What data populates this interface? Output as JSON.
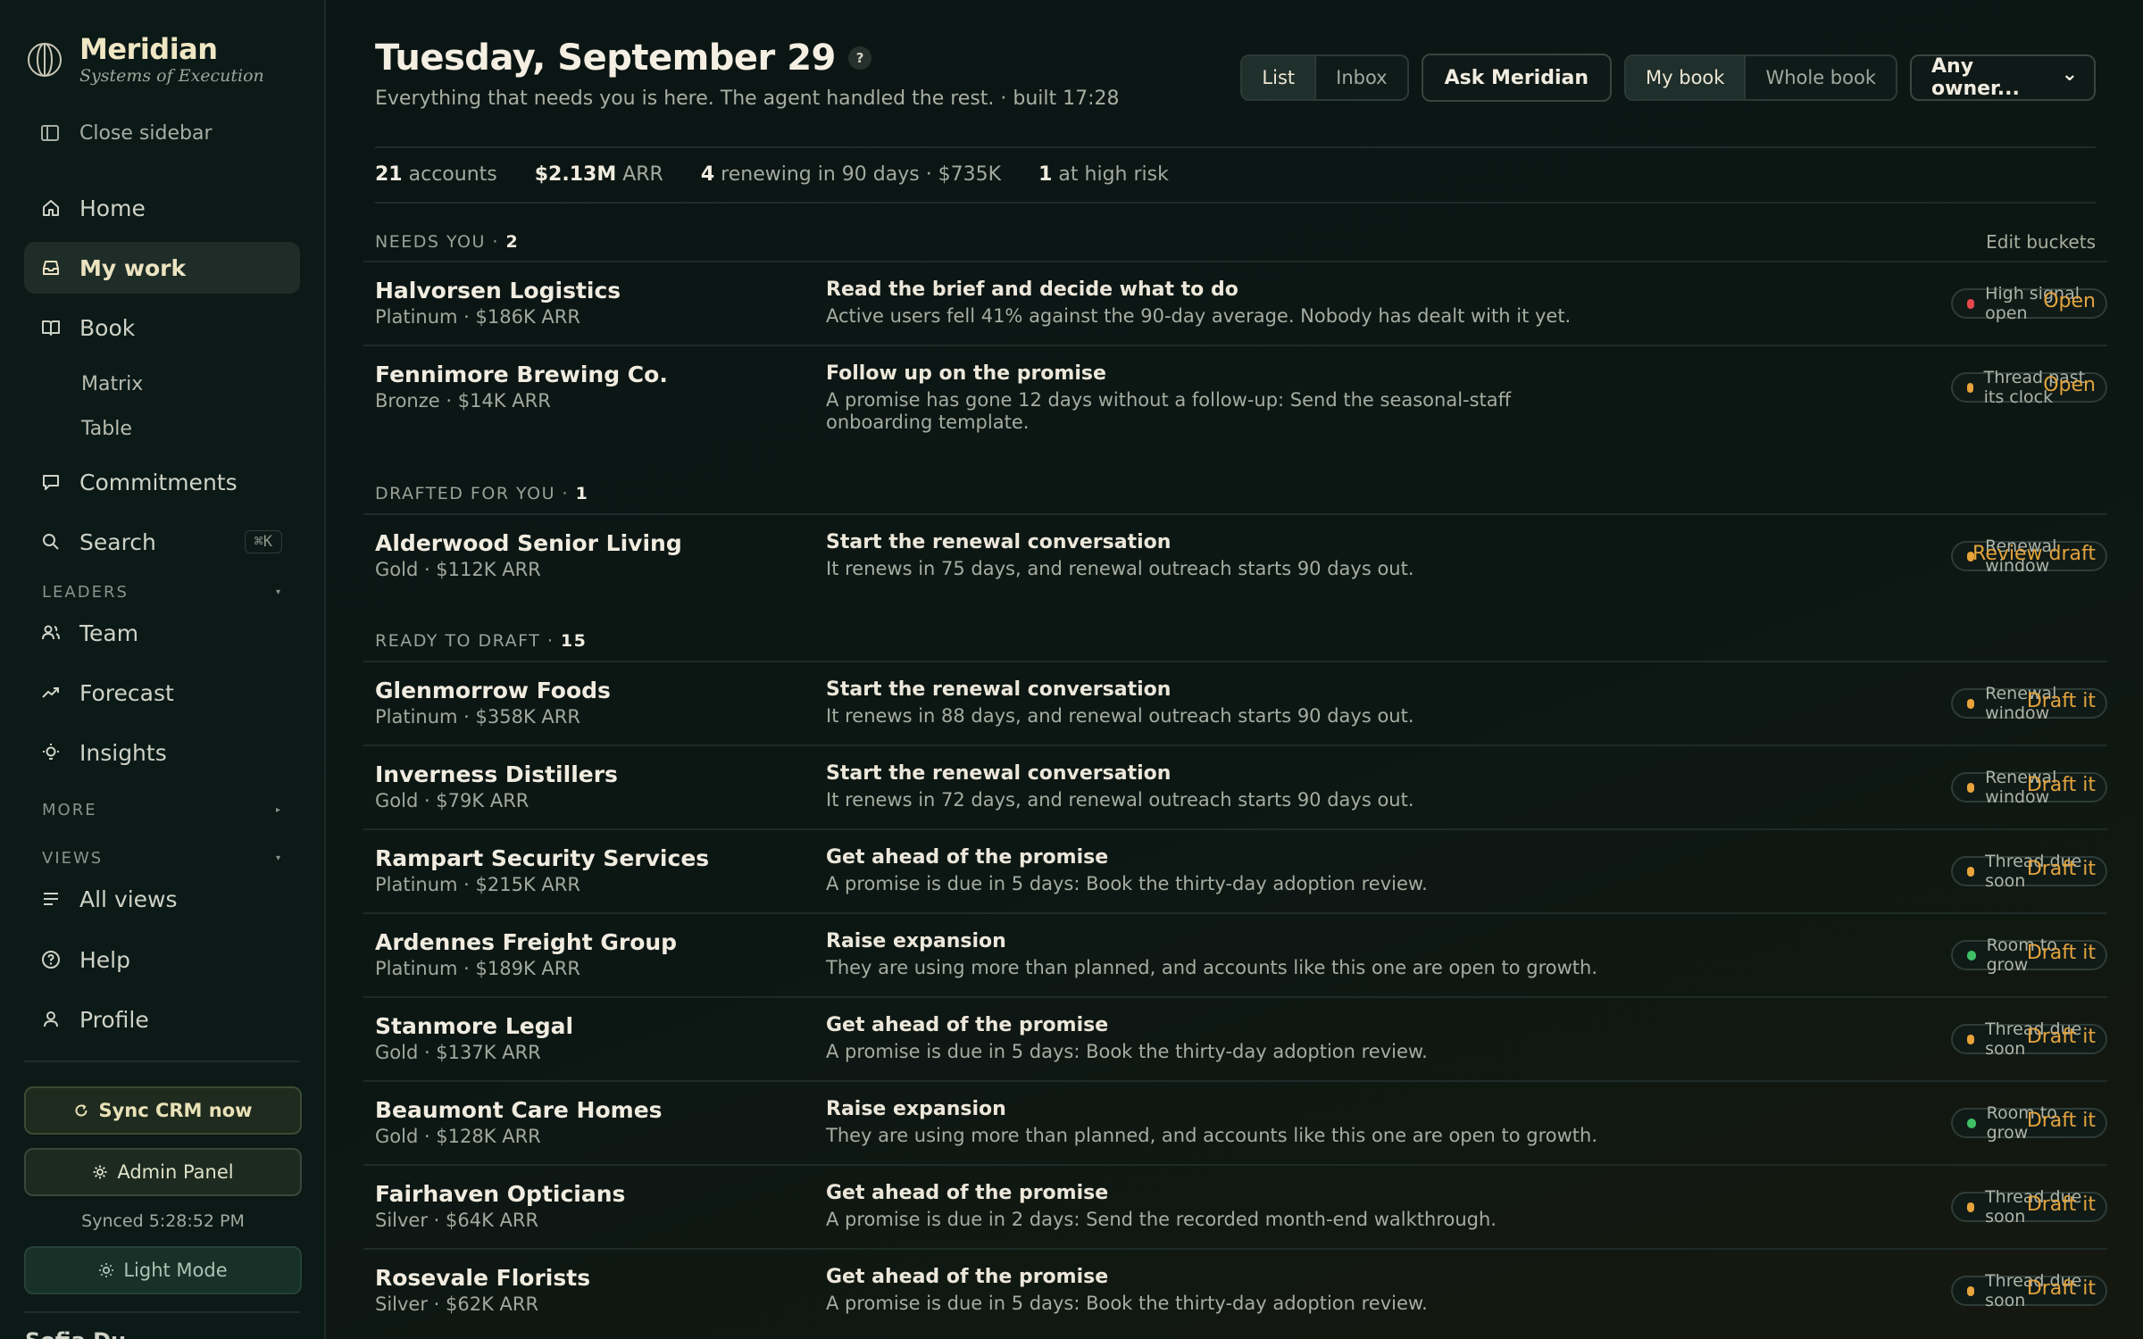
{
  "brand": {
    "name": "Meridian",
    "tagline": "Systems of Execution"
  },
  "sidebar": {
    "close_label": "Close sidebar",
    "nav": [
      {
        "label": "Home",
        "icon": "home-icon"
      },
      {
        "label": "My work",
        "icon": "inbox-icon",
        "active": true
      },
      {
        "label": "Book",
        "icon": "book-icon"
      }
    ],
    "book_sub": [
      "Matrix",
      "Table"
    ],
    "commitments": "Commitments",
    "search": "Search",
    "search_kbd": "⌘K",
    "leaders_label": "LEADERS",
    "leaders": [
      {
        "label": "Team",
        "icon": "users-icon"
      },
      {
        "label": "Forecast",
        "icon": "trend-icon"
      },
      {
        "label": "Insights",
        "icon": "bulb-icon"
      }
    ],
    "more_label": "MORE",
    "views_label": "VIEWS",
    "all_views": "All views",
    "help": "Help",
    "profile": "Profile",
    "sync_label": "Sync CRM now",
    "admin_label": "Admin Panel",
    "synced_text": "Synced 5:28:52 PM",
    "light_mode_label": "Light Mode",
    "user_name": "Sofia Du"
  },
  "header": {
    "title": "Tuesday, September 29",
    "help": "?",
    "subtitle": "Everything that needs you is here. The agent handled the rest. · built 17:28"
  },
  "toolbar": {
    "view_list": "List",
    "view_inbox": "Inbox",
    "ask": "Ask Meridian",
    "scope_mine": "My book",
    "scope_whole": "Whole book",
    "owner": "Any owner...",
    "owner_caret": "⌄"
  },
  "stats": {
    "accounts_num": "21",
    "accounts_label": "accounts",
    "arr_num": "$2.13M",
    "arr_label": "ARR",
    "renewing_num": "4",
    "renewing_label": "renewing in 90 days · $735K",
    "risk_num": "1",
    "risk_label": "at high risk"
  },
  "buckets": {
    "needs": {
      "label": "NEEDS YOU · ",
      "count": "2",
      "edit": "Edit buckets"
    },
    "drafted": {
      "label": "DRAFTED FOR YOU · ",
      "count": "1"
    },
    "ready": {
      "label": "READY TO DRAFT · ",
      "count": "15"
    }
  },
  "colors": {
    "red": "#e5484d",
    "amber": "#e8a33a",
    "green": "#3fbf66",
    "action": "#e3a33c"
  },
  "rows": [
    {
      "name": "Halvorsen Logistics",
      "meta": "Platinum · $186K ARR",
      "title": "Read the brief and decide what to do",
      "desc": "Active users fell 41% against the 90-day average. Nobody has dealt with it yet.",
      "badge": "High signal open",
      "dot": "red",
      "action": "Open"
    },
    {
      "name": "Fennimore Brewing Co.",
      "meta": "Bronze · $14K ARR",
      "title": "Follow up on the promise",
      "desc": "A promise has gone 12 days without a follow-up: Send the seasonal-staff onboarding template.",
      "badge": "Thread past its clock",
      "dot": "amber",
      "action": "Open"
    },
    {
      "name": "Alderwood Senior Living",
      "meta": "Gold · $112K ARR",
      "title": "Start the renewal conversation",
      "desc": "It renews in 75 days, and renewal outreach starts 90 days out.",
      "badge": "Renewal window",
      "dot": "amber",
      "action": "Review draft"
    },
    {
      "name": "Glenmorrow Foods",
      "meta": "Platinum · $358K ARR",
      "title": "Start the renewal conversation",
      "desc": "It renews in 88 days, and renewal outreach starts 90 days out.",
      "badge": "Renewal window",
      "dot": "amber",
      "action": "Draft it"
    },
    {
      "name": "Inverness Distillers",
      "meta": "Gold · $79K ARR",
      "title": "Start the renewal conversation",
      "desc": "It renews in 72 days, and renewal outreach starts 90 days out.",
      "badge": "Renewal window",
      "dot": "amber",
      "action": "Draft it"
    },
    {
      "name": "Rampart Security Services",
      "meta": "Platinum · $215K ARR",
      "title": "Get ahead of the promise",
      "desc": "A promise is due in 5 days: Book the thirty-day adoption review.",
      "badge": "Thread due soon",
      "dot": "amber",
      "action": "Draft it"
    },
    {
      "name": "Ardennes Freight Group",
      "meta": "Platinum · $189K ARR",
      "title": "Raise expansion",
      "desc": "They are using more than planned, and accounts like this one are open to growth.",
      "badge": "Room to grow",
      "dot": "green",
      "action": "Draft it"
    },
    {
      "name": "Stanmore Legal",
      "meta": "Gold · $137K ARR",
      "title": "Get ahead of the promise",
      "desc": "A promise is due in 5 days: Book the thirty-day adoption review.",
      "badge": "Thread due soon",
      "dot": "amber",
      "action": "Draft it"
    },
    {
      "name": "Beaumont Care Homes",
      "meta": "Gold · $128K ARR",
      "title": "Raise expansion",
      "desc": "They are using more than planned, and accounts like this one are open to growth.",
      "badge": "Room to grow",
      "dot": "green",
      "action": "Draft it"
    },
    {
      "name": "Fairhaven Opticians",
      "meta": "Silver · $64K ARR",
      "title": "Get ahead of the promise",
      "desc": "A promise is due in 2 days: Send the recorded month-end walkthrough.",
      "badge": "Thread due soon",
      "dot": "amber",
      "action": "Draft it"
    },
    {
      "name": "Rosevale Florists",
      "meta": "Silver · $62K ARR",
      "title": "Get ahead of the promise",
      "desc": "A promise is due in 5 days: Book the thirty-day adoption review.",
      "badge": "Thread due soon",
      "dot": "amber",
      "action": "Draft it"
    }
  ]
}
